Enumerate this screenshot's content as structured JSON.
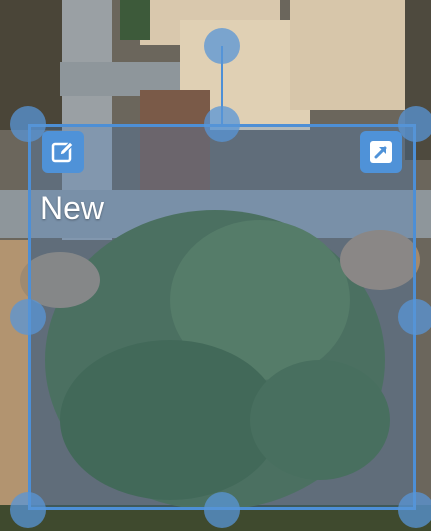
{
  "selection": {
    "label": "New"
  },
  "colors": {
    "accent": "#4d8fd6",
    "button": "#4f92d8",
    "handle": "#5896d7"
  },
  "icons": {
    "edit": "edit-icon",
    "resize": "expand-arrow-icon"
  }
}
